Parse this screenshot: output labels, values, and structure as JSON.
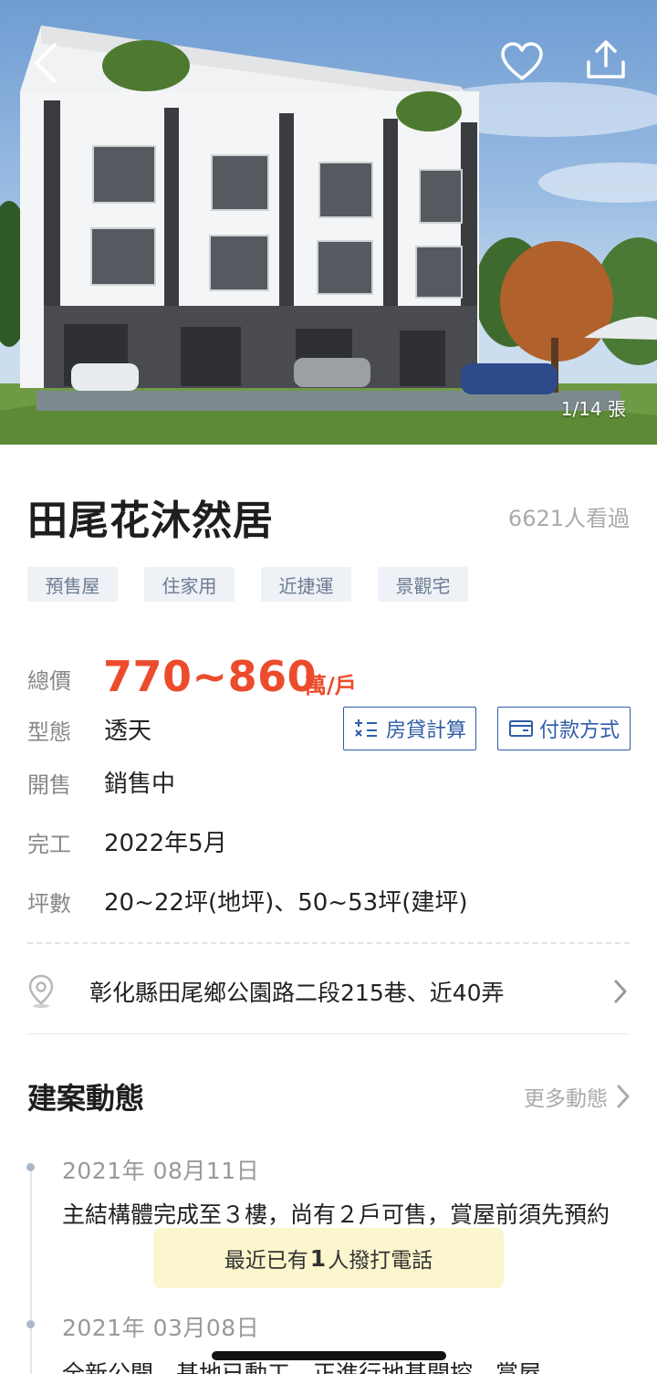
{
  "hero": {
    "photo_counter": "1/14 張"
  },
  "project": {
    "name": "田尾花沐然居",
    "views": "6621人看過",
    "tags": [
      "預售屋",
      "住家用",
      "近捷運",
      "景觀宅"
    ]
  },
  "info": {
    "price_label": "總價",
    "price_value": "770~860",
    "price_unit": "萬/戶",
    "type_label": "型態",
    "type_value": "透天",
    "sale_label": "開售",
    "sale_value": "銷售中",
    "complete_label": "完工",
    "complete_value": "2022年5月",
    "area_label": "坪數",
    "area_value": "20~22坪(地坪)、50~53坪(建坪)"
  },
  "actions": {
    "loan_label": "房貸計算",
    "payment_label": "付款方式"
  },
  "address": {
    "text": "彰化縣田尾鄉公園路二段215巷、近40弄"
  },
  "news": {
    "title": "建案動態",
    "more_label": "更多動態",
    "items": [
      {
        "date": "2021年 08月11日",
        "text": "主結構體完成至３樓，尚有２戶可售，賞屋前須先預約"
      },
      {
        "date": "2021年 03月08日",
        "text": "全新公開，基地已動工，正進行地基開挖，賞屋"
      }
    ]
  },
  "toast": {
    "prefix": "最近已有",
    "count": "1",
    "suffix": "人撥打電話"
  },
  "colors": {
    "price": "#ec4b2c",
    "button_border": "#2f5da8",
    "tag_bg": "#eef1f5",
    "toast_bg": "#fbf6cd"
  }
}
